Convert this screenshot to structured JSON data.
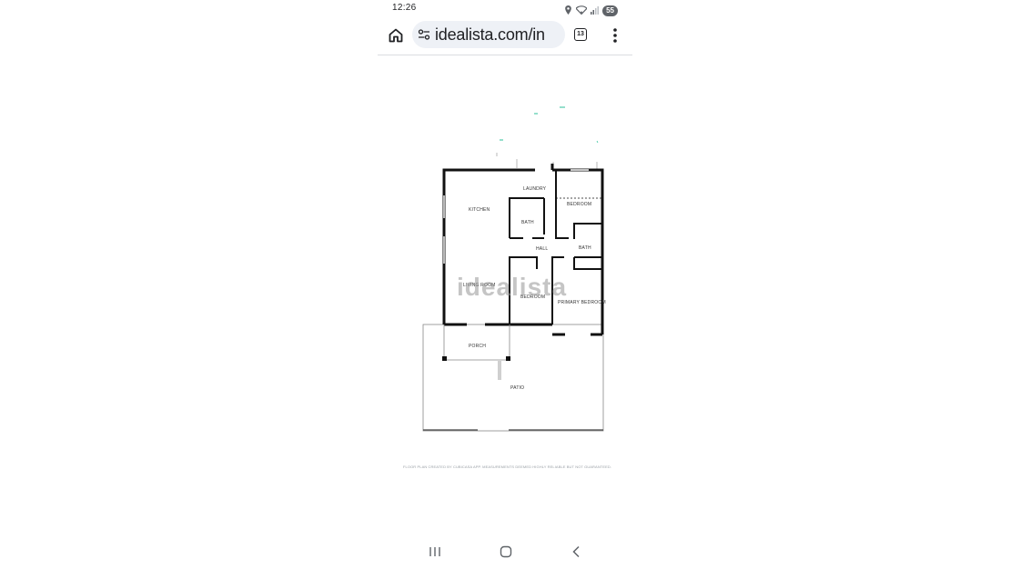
{
  "status_bar": {
    "time": "12:26",
    "battery": "55",
    "icons": [
      "location-icon",
      "wifi-icon",
      "signal-icon"
    ]
  },
  "toolbar": {
    "url": "idealista.com/in",
    "tab_count": "13",
    "icons": [
      "home-icon",
      "site-settings-icon",
      "tabs-icon",
      "more-vert-icon"
    ]
  },
  "floor_plan": {
    "rooms": {
      "laundry": "LAUNDRY",
      "kitchen": "KITCHEN",
      "bedroom_top": "BEDROOM",
      "bath_left": "BATH",
      "hall": "HALL",
      "bath_right": "BATH",
      "living_room": "LIVING ROOM",
      "bedroom_middle": "BEDROOM",
      "primary_bedroom": "PRIMARY BEDROOM",
      "porch": "PORCH",
      "patio": "PATIO"
    },
    "watermark": "idealista",
    "credit": "FLOOR PLAN CREATED BY CUBICASA APP. MEASUREMENTS DEEMED HIGHLY RELIABLE BUT NOT GUARANTEED."
  },
  "nav_bar": {
    "icons": [
      "recent-apps-icon",
      "home-nav-icon",
      "back-icon"
    ]
  },
  "colors": {
    "wall": "#111111",
    "accent_marks": "#2bbf9a",
    "pill_bg": "#eef1f6"
  }
}
